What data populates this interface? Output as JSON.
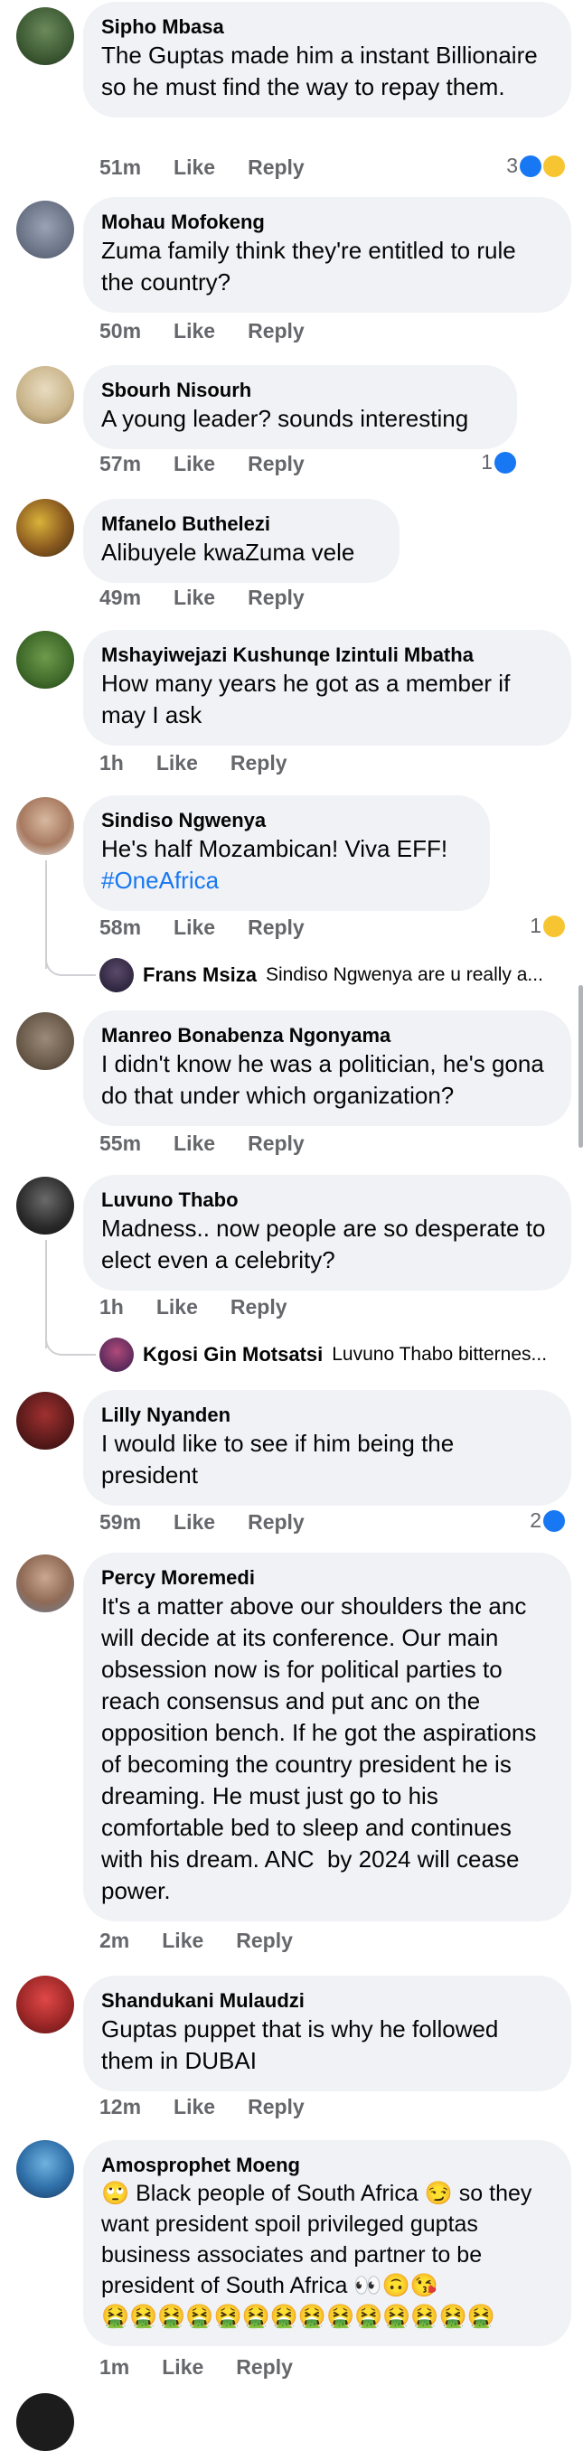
{
  "ui": {
    "like": "Like",
    "reply": "Reply"
  },
  "comments": [
    {
      "name": "Sipho Mbasa",
      "text": "The Guptas made him a instant Billionaire so he must find the way to repay them.",
      "time": "51m",
      "reaction_count": "3",
      "reactions": [
        "like-icon",
        "haha-icon"
      ]
    },
    {
      "name": "Mohau Mofokeng",
      "text": "Zuma family think they're entitled to rule the country?",
      "time": "50m"
    },
    {
      "name": "Sbourh Nisourh",
      "text": "A young leader? sounds interesting",
      "time": "57m",
      "reaction_count": "1",
      "reactions": [
        "like-icon"
      ]
    },
    {
      "name": "Mfanelo Buthelezi",
      "text": "Alibuyele kwaZuma vele",
      "time": "49m"
    },
    {
      "name": "Mshayiwejazi Kushunqe Izintuli Mbatha",
      "text": "How many years he got as a member if may I ask",
      "time": "1h"
    },
    {
      "name": "Sindiso Ngwenya",
      "text": "He's half Mozambican! Viva EFF!",
      "hashtag": "#OneAfrica",
      "time": "58m",
      "reaction_count": "1",
      "reactions": [
        "haha-icon"
      ],
      "reply": {
        "name": "Frans Msiza",
        "text": "Sindiso Ngwenya are u really a..."
      }
    },
    {
      "name": "Manreo Bonabenza Ngonyama",
      "text": "I didn't know he was a politician, he's gona do that under which organization?",
      "time": "55m"
    },
    {
      "name": "Luvuno Thabo",
      "text": "Madness.. now people are so desperate to elect even a celebrity?",
      "time": "1h",
      "reply": {
        "name": "Kgosi Gin Motsatsi",
        "text": "Luvuno Thabo bitternes..."
      }
    },
    {
      "name": "Lilly Nyanden",
      "text": "I would like to see if him being the president",
      "time": "59m",
      "reaction_count": "2",
      "reactions": [
        "like-icon"
      ]
    },
    {
      "name": "Percy Moremedi",
      "text": "It's a matter above our shoulders the anc will decide at its conference. Our main obsession now is for political parties to reach consensus and put anc on the opposition bench. If he got the aspirations  of becoming the country president he is dreaming. He must just go to his comfortable bed to sleep and continues with his dream. ANC  by 2024 will cease power.",
      "time": "2m"
    },
    {
      "name": "Shandukani Mulaudzi",
      "text": "Guptas puppet that is why he followed them in DUBAI",
      "time": "12m"
    },
    {
      "name": "Amosprophet Moeng",
      "text": "🙄 Black people of South Africa 😏 so they want president spoil privileged guptas business associates and partner to be president of South Africa 👀🙃😘\n🤮🤮🤮🤮🤮🤮🤮🤮🤮🤮🤮🤮🤮🤮",
      "time": "1m"
    }
  ]
}
